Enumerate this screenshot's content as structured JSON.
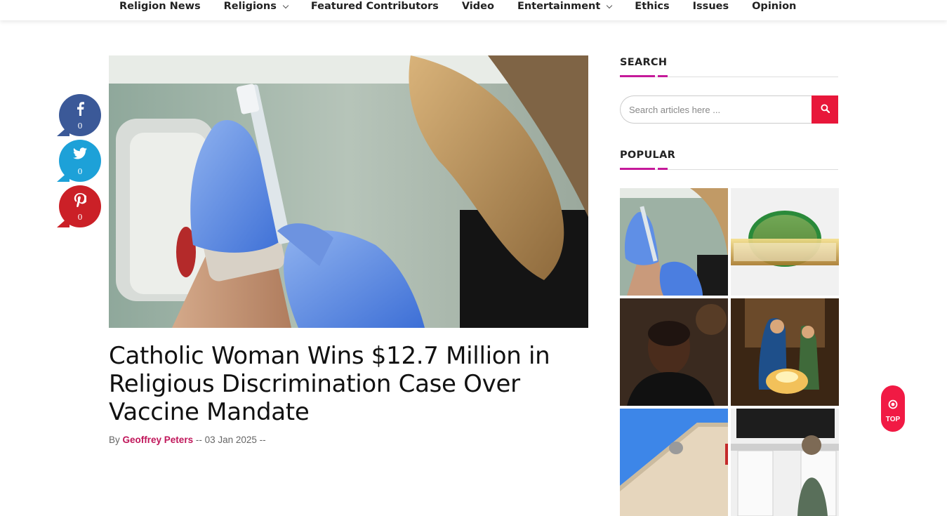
{
  "nav": {
    "items": [
      {
        "label": "Religion News",
        "dropdown": false
      },
      {
        "label": "Religions",
        "dropdown": true
      },
      {
        "label": "Featured Contributors",
        "dropdown": false
      },
      {
        "label": "Video",
        "dropdown": false
      },
      {
        "label": "Entertainment",
        "dropdown": true
      },
      {
        "label": "Ethics",
        "dropdown": false
      },
      {
        "label": "Issues",
        "dropdown": false
      },
      {
        "label": "Opinion",
        "dropdown": false
      }
    ]
  },
  "share": {
    "facebook_count": "0",
    "twitter_count": "0",
    "pinterest_count": "0"
  },
  "article": {
    "title": "Catholic Woman Wins $12.7 Million in Religious Discrimination Case Over Vaccine Mandate",
    "by": "By",
    "author": "Geoffrey Peters",
    "date": "-- 03 Jan 2025 --",
    "date_prefix": "--"
  },
  "sidebar": {
    "search_heading": "SEARCH",
    "search_placeholder": "Search articles here ...",
    "popular_heading": "POPULAR"
  },
  "top_button": {
    "label": "TOP"
  },
  "colors": {
    "accent": "#c51a9a",
    "search_button": "#e8173a",
    "author": "#c0165a",
    "facebook": "#3b5998",
    "twitter": "#1da1d8",
    "pinterest": "#cb2027",
    "top_button": "#f11a44"
  },
  "icons": {
    "facebook": "facebook-icon",
    "twitter": "twitter-icon",
    "pinterest": "pinterest-icon",
    "search": "search-icon",
    "top": "target-icon",
    "dropdown": "chevron-down-icon"
  }
}
